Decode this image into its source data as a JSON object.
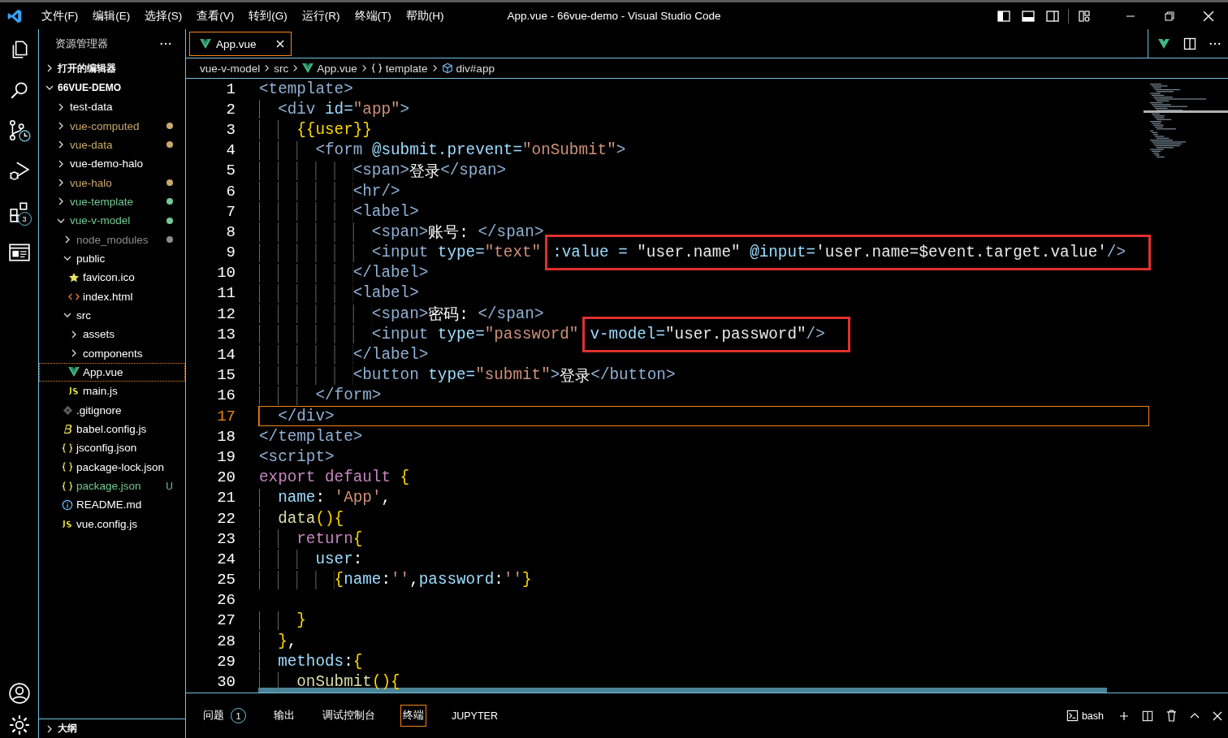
{
  "window": {
    "title": "App.vue - 66vue-demo - Visual Studio Code"
  },
  "menu": [
    "文件(F)",
    "编辑(E)",
    "选择(S)",
    "查看(V)",
    "转到(G)",
    "运行(R)",
    "终端(T)",
    "帮助(H)"
  ],
  "activity_bar": {
    "extensions_badge": "3"
  },
  "explorer": {
    "title": "资源管理器",
    "sections": [
      {
        "label": "打开的编辑器",
        "expanded": false
      },
      {
        "label": "66VUE-DEMO",
        "expanded": true
      }
    ],
    "items": [
      {
        "label": "test-data",
        "kind": "folder",
        "expanded": false,
        "selected": false
      },
      {
        "label": "vue-computed",
        "kind": "folder",
        "expanded": false,
        "selected": false,
        "color": "#c9a96b"
      },
      {
        "label": "vue-data",
        "kind": "folder",
        "expanded": false,
        "selected": false,
        "color": "#c9a96b"
      },
      {
        "label": "vue-demo-halo",
        "kind": "folder",
        "expanded": false,
        "selected": false
      },
      {
        "label": "vue-halo",
        "kind": "folder",
        "expanded": false,
        "selected": false,
        "color": "#c9a96b"
      },
      {
        "label": "vue-template",
        "kind": "folder",
        "expanded": false,
        "selected": false,
        "color": "#73c991"
      },
      {
        "label": "vue-v-model",
        "kind": "folder",
        "expanded": true,
        "selected": false,
        "color": "#73c991",
        "children": [
          {
            "label": "node_modules",
            "kind": "folder",
            "expanded": false,
            "selected": false,
            "color": "#8c8c8c"
          },
          {
            "label": "public",
            "kind": "folder",
            "expanded": true,
            "selected": false,
            "children": [
              {
                "label": "favicon.ico",
                "kind": "star",
                "selected": false
              },
              {
                "label": "index.html",
                "kind": "html",
                "selected": false
              }
            ]
          },
          {
            "label": "src",
            "kind": "folder",
            "expanded": true,
            "selected": false,
            "children": [
              {
                "label": "assets",
                "kind": "folder",
                "expanded": false,
                "selected": false
              },
              {
                "label": "components",
                "kind": "folder",
                "expanded": false,
                "selected": false
              },
              {
                "label": "App.vue",
                "kind": "vue",
                "selected": true
              },
              {
                "label": "main.js",
                "kind": "js",
                "selected": false
              }
            ]
          },
          {
            "label": ".gitignore",
            "kind": "git",
            "selected": false
          },
          {
            "label": "babel.config.js",
            "kind": "babel",
            "selected": false
          },
          {
            "label": "jsconfig.json",
            "kind": "json",
            "selected": false
          },
          {
            "label": "package-lock.json",
            "kind": "json",
            "selected": false
          },
          {
            "label": "package.json",
            "kind": "json",
            "selected": false,
            "color": "#73c991",
            "badge": "U"
          },
          {
            "label": "README.md",
            "kind": "info",
            "selected": false
          },
          {
            "label": "vue.config.js",
            "kind": "js",
            "selected": false
          }
        ]
      }
    ],
    "outline": {
      "label": "大纲",
      "expanded": false
    }
  },
  "tabs": [
    {
      "label": "App.vue",
      "kind": "vue",
      "selected": true
    }
  ],
  "breadcrumbs": [
    {
      "label": "vue-v-model"
    },
    {
      "label": "src"
    },
    {
      "label": "App.vue",
      "kind": "vue"
    },
    {
      "label": "template",
      "kind": "braces"
    },
    {
      "label": "div#app",
      "kind": "cube"
    }
  ],
  "editor": {
    "lines": [
      {
        "number": "1",
        "current": false,
        "tokens": [
          {
            "kind": "tag",
            "text": "<template>"
          }
        ]
      },
      {
        "number": "2",
        "current": false,
        "tokens": [
          {
            "kind": "tag",
            "text": "  <div "
          },
          {
            "kind": "attr",
            "text": "id="
          },
          {
            "kind": "str",
            "text": "\"app\""
          },
          {
            "kind": "tag",
            "text": ">"
          }
        ]
      },
      {
        "number": "3",
        "current": false,
        "tokens": [
          {
            "kind": "brace",
            "text": "    {{user}}"
          }
        ]
      },
      {
        "number": "4",
        "current": false,
        "tokens": [
          {
            "kind": "tag",
            "text": "      <form "
          },
          {
            "kind": "attr",
            "text": "@submit.prevent="
          },
          {
            "kind": "str",
            "text": "\"onSubmit\""
          },
          {
            "kind": "tag",
            "text": ">"
          }
        ]
      },
      {
        "number": "5",
        "current": false,
        "tokens": [
          {
            "kind": "tag",
            "text": "          <span>"
          },
          {
            "kind": "text",
            "text": "登录"
          },
          {
            "kind": "tag",
            "text": "</span>"
          }
        ]
      },
      {
        "number": "6",
        "current": false,
        "tokens": [
          {
            "kind": "tag",
            "text": "          <hr/>"
          }
        ]
      },
      {
        "number": "7",
        "current": false,
        "tokens": [
          {
            "kind": "tag",
            "text": "          <label>"
          }
        ]
      },
      {
        "number": "8",
        "current": false,
        "tokens": [
          {
            "kind": "tag",
            "text": "            <span>"
          },
          {
            "kind": "text",
            "text": "账号: "
          },
          {
            "kind": "tag",
            "text": "</span>"
          }
        ]
      },
      {
        "number": "9",
        "current": false,
        "tokens": [
          {
            "kind": "tag",
            "text": "            <input "
          },
          {
            "kind": "attr",
            "text": "type="
          },
          {
            "kind": "str",
            "text": "\"text\""
          },
          {
            "kind": "highlight",
            "tokens": [
              {
                "kind": "attr",
                "text": ":value = "
              },
              {
                "kind": "expr",
                "text": "\"user.name\" "
              },
              {
                "kind": "attr",
                "text": "@input="
              },
              {
                "kind": "expr",
                "text": "'user.name=$event.target.value'"
              },
              {
                "kind": "tag",
                "text": "/>"
              }
            ]
          }
        ]
      },
      {
        "number": "10",
        "current": false,
        "tokens": [
          {
            "kind": "tag",
            "text": "          </label>"
          }
        ]
      },
      {
        "number": "11",
        "current": false,
        "tokens": [
          {
            "kind": "tag",
            "text": "          <label>"
          }
        ]
      },
      {
        "number": "12",
        "current": false,
        "tokens": [
          {
            "kind": "tag",
            "text": "            <span>"
          },
          {
            "kind": "text",
            "text": "密码: "
          },
          {
            "kind": "tag",
            "text": "</span>"
          }
        ]
      },
      {
        "number": "13",
        "current": false,
        "tokens": [
          {
            "kind": "tag",
            "text": "            <input "
          },
          {
            "kind": "attr",
            "text": "type="
          },
          {
            "kind": "str",
            "text": "\"password\""
          },
          {
            "kind": "highlight",
            "tokens": [
              {
                "kind": "attr",
                "text": "v-model="
              },
              {
                "kind": "expr",
                "text": "\"user.password\""
              },
              {
                "kind": "tag",
                "text": "/>"
              }
            ]
          }
        ]
      },
      {
        "number": "14",
        "current": false,
        "tokens": [
          {
            "kind": "tag",
            "text": "          </label>"
          }
        ]
      },
      {
        "number": "15",
        "current": false,
        "tokens": [
          {
            "kind": "tag",
            "text": "          <button "
          },
          {
            "kind": "attr",
            "text": "type="
          },
          {
            "kind": "str",
            "text": "\"submit\""
          },
          {
            "kind": "tag",
            "text": ">"
          },
          {
            "kind": "text",
            "text": "登录"
          },
          {
            "kind": "tag",
            "text": "</button>"
          }
        ]
      },
      {
        "number": "16",
        "current": false,
        "tokens": [
          {
            "kind": "tag",
            "text": "      </form>"
          }
        ]
      },
      {
        "number": "17",
        "current": true,
        "tokens": [
          {
            "kind": "tag",
            "text": "  </div>"
          }
        ]
      },
      {
        "number": "18",
        "current": false,
        "tokens": [
          {
            "kind": "tag",
            "text": "</template>"
          }
        ]
      },
      {
        "number": "19",
        "current": false,
        "tokens": [
          {
            "kind": "tag",
            "text": "<script>"
          }
        ]
      },
      {
        "number": "20",
        "current": false,
        "tokens": [
          {
            "kind": "keyword",
            "text": "export default "
          },
          {
            "kind": "brace",
            "text": "{"
          }
        ]
      },
      {
        "number": "21",
        "current": false,
        "tokens": [
          {
            "kind": "prop",
            "text": "  name"
          },
          {
            "kind": "punct",
            "text": ": "
          },
          {
            "kind": "str",
            "text": "'App'"
          },
          {
            "kind": "punct",
            "text": ","
          }
        ]
      },
      {
        "number": "22",
        "current": false,
        "tokens": [
          {
            "kind": "func",
            "text": "  data"
          },
          {
            "kind": "brace",
            "text": "(){"
          }
        ]
      },
      {
        "number": "23",
        "current": false,
        "tokens": [
          {
            "kind": "keyword",
            "text": "    return"
          },
          {
            "kind": "brace",
            "text": "{"
          }
        ]
      },
      {
        "number": "24",
        "current": false,
        "tokens": [
          {
            "kind": "prop",
            "text": "      user"
          },
          {
            "kind": "punct",
            "text": ":"
          }
        ]
      },
      {
        "number": "25",
        "current": false,
        "tokens": [
          {
            "kind": "brace",
            "text": "        {"
          },
          {
            "kind": "prop",
            "text": "name"
          },
          {
            "kind": "punct",
            "text": ":"
          },
          {
            "kind": "str",
            "text": "''"
          },
          {
            "kind": "punct",
            "text": ","
          },
          {
            "kind": "prop",
            "text": "password"
          },
          {
            "kind": "punct",
            "text": ":"
          },
          {
            "kind": "str",
            "text": "''"
          },
          {
            "kind": "brace",
            "text": "}"
          }
        ]
      },
      {
        "number": "26",
        "current": false
      },
      {
        "number": "27",
        "current": false,
        "tokens": [
          {
            "kind": "brace",
            "text": "    }"
          }
        ]
      },
      {
        "number": "28",
        "current": false,
        "tokens": [
          {
            "kind": "brace",
            "text": "  }"
          },
          {
            "kind": "punct",
            "text": ","
          }
        ]
      },
      {
        "number": "29",
        "current": false,
        "tokens": [
          {
            "kind": "prop",
            "text": "  methods"
          },
          {
            "kind": "punct",
            "text": ":"
          },
          {
            "kind": "brace",
            "text": "{"
          }
        ]
      },
      {
        "number": "30",
        "current": false,
        "tokens": [
          {
            "kind": "func",
            "text": "    onSubmit"
          },
          {
            "kind": "brace",
            "text": "(){"
          }
        ]
      }
    ]
  },
  "panel": {
    "tabs": [
      {
        "label": "问题",
        "badge": "1",
        "selected": false
      },
      {
        "label": "输出",
        "selected": false
      },
      {
        "label": "调试控制台",
        "selected": false
      },
      {
        "label": "终端",
        "selected": true
      },
      {
        "label": "JUPYTER",
        "selected": false
      }
    ],
    "terminal": {
      "label": "bash"
    }
  }
}
